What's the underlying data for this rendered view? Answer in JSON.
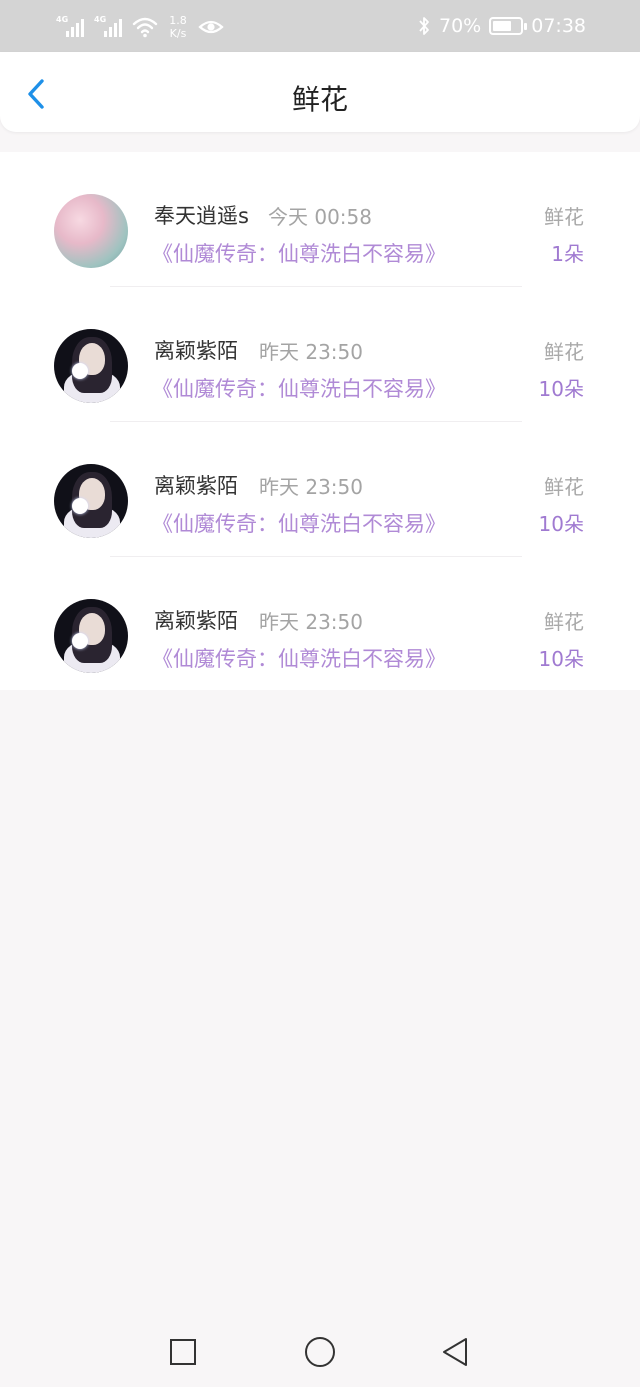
{
  "status_bar": {
    "net1": "4G",
    "net2": "4G",
    "speed_value": "1.8",
    "speed_unit": "K/s",
    "battery_percent": "70%",
    "battery_level": 0.7,
    "clock": "07:38"
  },
  "header": {
    "title": "鲜花"
  },
  "records": [
    {
      "user": "奉天逍遥s",
      "time": "今天 00:58",
      "book": "《仙魔传奇：仙尊洗白不容易》",
      "type": "鲜花",
      "count": "1朵"
    },
    {
      "user": "离颖紫陌",
      "time": "昨天 23:50",
      "book": "《仙魔传奇：仙尊洗白不容易》",
      "type": "鲜花",
      "count": "10朵"
    },
    {
      "user": "离颖紫陌",
      "time": "昨天 23:50",
      "book": "《仙魔传奇：仙尊洗白不容易》",
      "type": "鲜花",
      "count": "10朵"
    },
    {
      "user": "离颖紫陌",
      "time": "昨天 23:50",
      "book": "《仙魔传奇：仙尊洗白不容易》",
      "type": "鲜花",
      "count": "10朵"
    }
  ],
  "colors": {
    "accent_blue": "#1e90e8",
    "book_purple": "#b08ad6",
    "count_purple": "#a07ad1"
  },
  "icons": {
    "back": "chevron-left-icon",
    "nav_recent": "square-icon",
    "nav_home": "circle-icon",
    "nav_back": "triangle-back-icon"
  }
}
